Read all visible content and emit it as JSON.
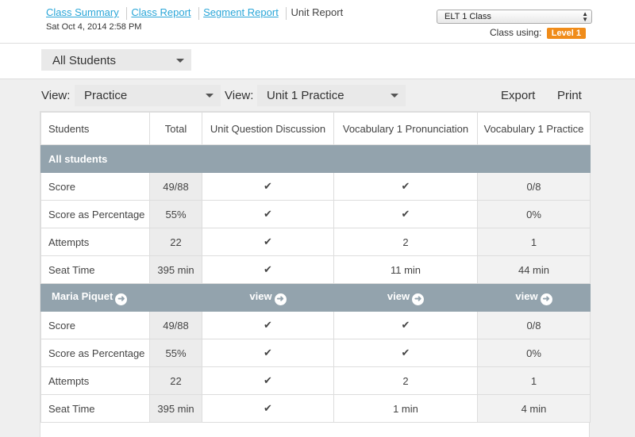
{
  "nav": {
    "links": [
      "Class Summary",
      "Class Report",
      "Segment Report"
    ],
    "current": "Unit Report",
    "timestamp": "Sat Oct 4, 2014 2:58 PM"
  },
  "class_selector": {
    "selected": "ELT 1 Class",
    "using_label": "Class using:",
    "level": "Level 1"
  },
  "student_filter": {
    "selected": "All Students"
  },
  "toolbar": {
    "view1_label": "View:",
    "view1_selected": "Practice",
    "view2_label": "View:",
    "view2_selected": "Unit 1 Practice",
    "export_label": "Export",
    "print_label": "Print"
  },
  "table": {
    "headers": [
      "Students",
      "Total",
      "Unit Question Discussion",
      "Vocabulary 1 Pronunciation",
      "Vocabulary 1 Practice"
    ],
    "checkmark": "✔",
    "groups": [
      {
        "name": "All students",
        "links": [
          "",
          "",
          ""
        ],
        "rows": [
          {
            "label": "Score",
            "total": "49/88",
            "c1": "✔",
            "c2": "✔",
            "c3": "0/8"
          },
          {
            "label": "Score as Percentage",
            "total": "55%",
            "c1": "✔",
            "c2": "✔",
            "c3": "0%"
          },
          {
            "label": "Attempts",
            "total": "22",
            "c1": "✔",
            "c2": "2",
            "c3": "1"
          },
          {
            "label": "Seat Time",
            "total": "395 min",
            "c1": "✔",
            "c2": "11 min",
            "c3": "44 min"
          }
        ]
      },
      {
        "name": "Maria Piquet",
        "links": [
          "view",
          "view",
          "view"
        ],
        "rows": [
          {
            "label": "Score",
            "total": "49/88",
            "c1": "✔",
            "c2": "✔",
            "c3": "0/8"
          },
          {
            "label": "Score as Percentage",
            "total": "55%",
            "c1": "✔",
            "c2": "✔",
            "c3": "0%"
          },
          {
            "label": "Attempts",
            "total": "22",
            "c1": "✔",
            "c2": "2",
            "c3": "1"
          },
          {
            "label": "Seat Time",
            "total": "395 min",
            "c1": "✔",
            "c2": "1 min",
            "c3": "4 min"
          }
        ]
      }
    ]
  }
}
